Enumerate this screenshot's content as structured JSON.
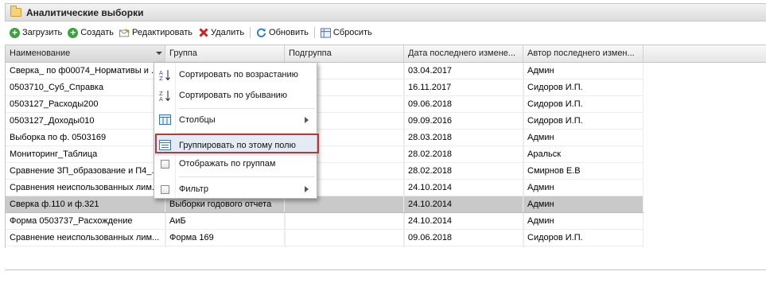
{
  "window": {
    "title": "Аналитические выборки"
  },
  "toolbar": {
    "load": "Загрузить",
    "create": "Создать",
    "edit": "Редактировать",
    "delete": "Удалить",
    "refresh": "Обновить",
    "reset": "Сбросить"
  },
  "columns": [
    "Наименование",
    "Группа",
    "Подгруппа",
    "Дата последнего измене...",
    "Автор последнего измен..."
  ],
  "rows": [
    {
      "name": "Сверка_ по ф00074_Нормативы и ...",
      "group": "",
      "sub": "",
      "date": "03.04.2017",
      "author": "Админ"
    },
    {
      "name": "0503710_Суб_Справка",
      "group": "",
      "sub": "",
      "date": "16.11.2017",
      "author": "Сидоров И.П."
    },
    {
      "name": "0503127_Расходы200",
      "group": "",
      "sub": "",
      "date": "09.06.2018",
      "author": "Сидоров И.П."
    },
    {
      "name": "0503127_Доходы010",
      "group": "",
      "sub": "",
      "date": "09.09.2016",
      "author": "Сидоров И.П."
    },
    {
      "name": "Выборка по ф. 0503169",
      "group": "",
      "sub": "",
      "date": "28.03.2018",
      "author": "Админ"
    },
    {
      "name": "Мониторинг_Таблица",
      "group": "",
      "sub": "",
      "date": "28.02.2018",
      "author": "Аральск"
    },
    {
      "name": "Сравнение ЗП_образование и П4_...",
      "group": "",
      "sub": "",
      "date": "28.02.2018",
      "author": "Смирнов Е.В"
    },
    {
      "name": "Сравнения неиспользованных лим...",
      "group": "",
      "sub": "",
      "date": "24.10.2014",
      "author": "Админ"
    },
    {
      "name": "Сверка ф.110 и ф.321",
      "group": "Выборки годового отчета",
      "sub": "",
      "date": "24.10.2014",
      "author": "Админ"
    },
    {
      "name": "Форма 0503737_Расхождение",
      "group": "АиБ",
      "sub": "",
      "date": "24.10.2014",
      "author": "Админ"
    },
    {
      "name": "Сравнение неиспользованных лим...",
      "group": "Форма 169",
      "sub": "",
      "date": "09.06.2018",
      "author": "Сидоров И.П."
    }
  ],
  "context_menu": {
    "sort_asc": "Сортировать по возрастанию",
    "sort_desc": "Сортировать по убыванию",
    "columns": "Столбцы",
    "group_by": "Группировать по этому полю",
    "show_groups": "Отображать по группам",
    "filter": "Фильтр"
  },
  "colors": {
    "selected_row": "#c9c9c9",
    "highlight_border": "#b23a3a",
    "add_icon": "#3ca23c",
    "delete_icon": "#cc2222"
  }
}
